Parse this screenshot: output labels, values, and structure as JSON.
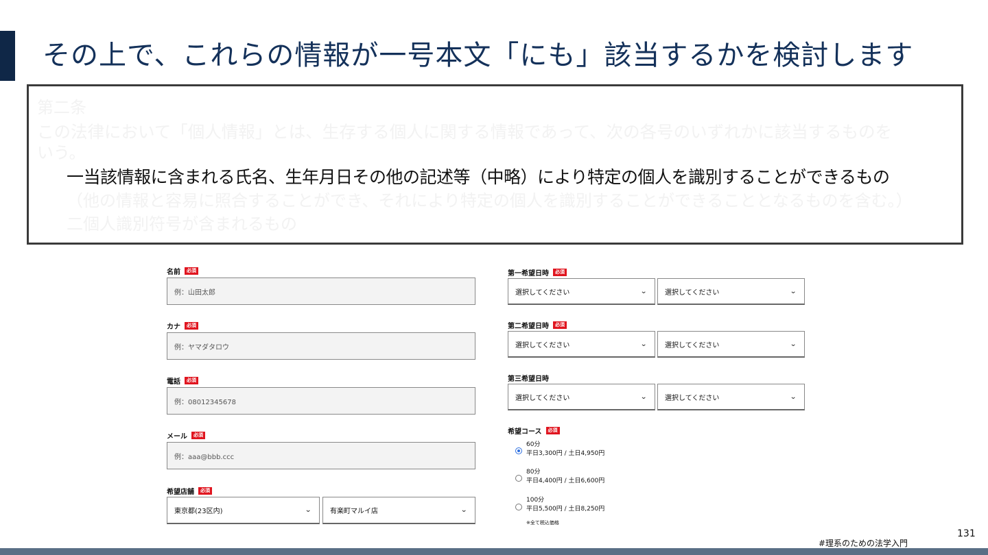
{
  "slide": {
    "title": "その上で、これらの情報が一号本文「にも」該当するかを検討します",
    "page_number": "131",
    "footer_tag": "#理系のための法学入門"
  },
  "law_text": {
    "article": "第二条",
    "intro_line1": "この法律において「個人情報」とは、生存する個人に関する情報であって、次の各号のいずれかに該当するものを",
    "intro_line2": "いう。",
    "item1": "一当該情報に含まれる氏名、生年月日その他の記述等（中略）により特定の個人を識別することができるもの",
    "item1_note": "（他の情報と容易に照合することができ、それにより特定の個人を識別することができることとなるものを含む。）",
    "item2": "二個人識別符号が含まれるもの"
  },
  "form": {
    "required_label": "必須",
    "name": {
      "label": "名前",
      "placeholder": "例：山田太郎"
    },
    "kana": {
      "label": "カナ",
      "placeholder": "例：ヤマダタロウ"
    },
    "phone": {
      "label": "電話",
      "placeholder": "例：08012345678"
    },
    "email": {
      "label": "メール",
      "placeholder": "例：aaa@bbb.ccc"
    },
    "store": {
      "label": "希望店舗",
      "area_value": "東京都(23区内)",
      "shop_value": "有楽町マルイ店"
    },
    "date1": {
      "label": "第一希望日時",
      "date_value": "選択してください",
      "time_value": "選択してください"
    },
    "date2": {
      "label": "第二希望日時",
      "date_value": "選択してください",
      "time_value": "選択してください"
    },
    "date3": {
      "label": "第三希望日時",
      "date_value": "選択してください",
      "time_value": "選択してください"
    },
    "course": {
      "label": "希望コース",
      "options": [
        {
          "name": "60分",
          "price": "平日3,300円 / 土日4,950円",
          "selected": true
        },
        {
          "name": "80分",
          "price": "平日4,400円 / 土日6,600円",
          "selected": false
        },
        {
          "name": "100分",
          "price": "平日5,500円 / 土日8,250円",
          "selected": false
        }
      ],
      "note": "※全て税込価格"
    }
  },
  "colors": {
    "title": "#14315a",
    "accent_bar": "#0f2747",
    "required_badge": "#e0151f",
    "bottom_bar": "#5a6f86",
    "radio_selected": "#2d6fe0"
  }
}
